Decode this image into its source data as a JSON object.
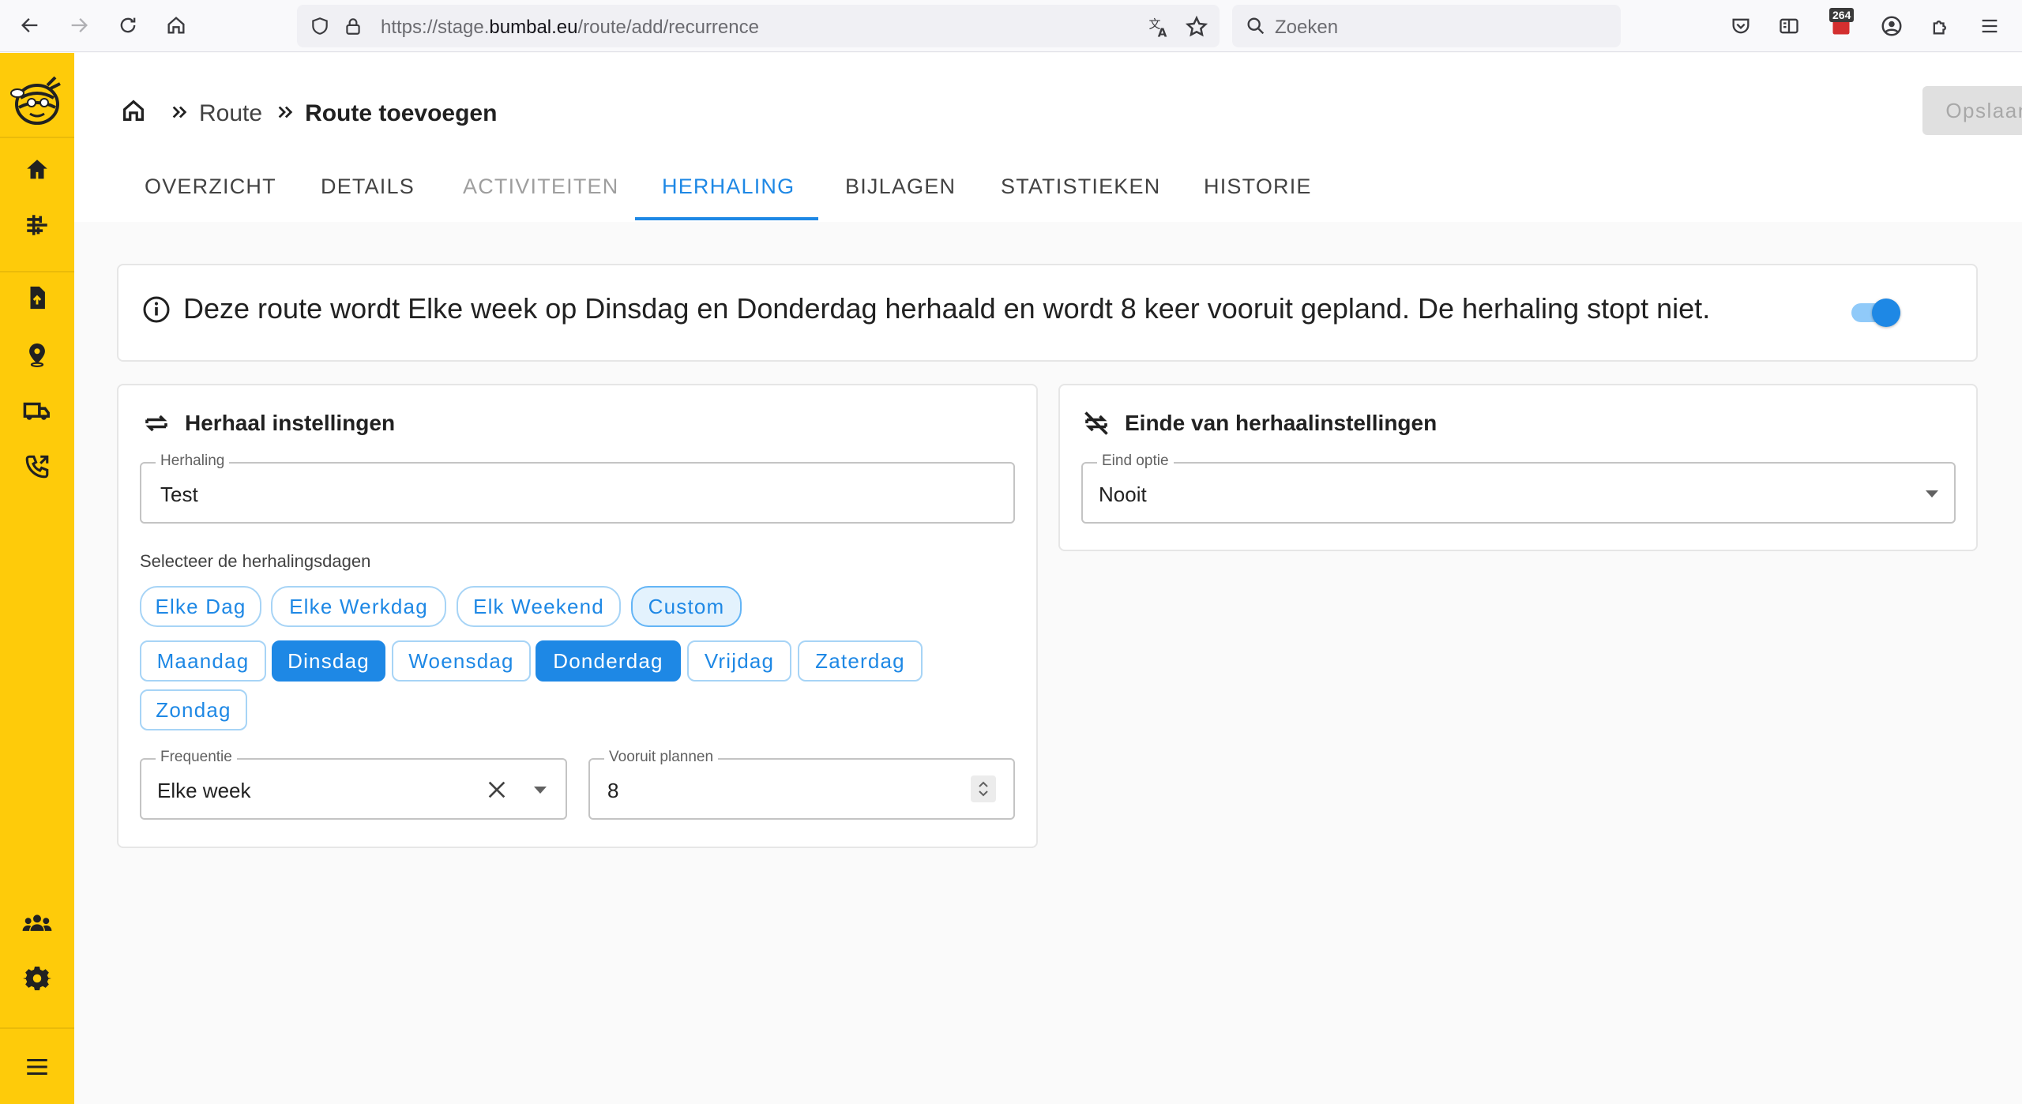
{
  "browser": {
    "url_prefix": "https://stage.",
    "url_domain": "bumbal.eu",
    "url_path": "/route/add/recurrence",
    "search_placeholder": "Zoeken",
    "extension_badge": "264",
    "icons": [
      "back-arrow-icon",
      "forward-arrow-icon",
      "reload-icon",
      "home-icon",
      "shield-icon",
      "lock-icon",
      "translate-icon",
      "star-icon",
      "search-icon",
      "pocket-icon",
      "reader-icon",
      "extension-icon",
      "account-icon",
      "puzzle-icon",
      "menu-icon"
    ]
  },
  "sidebar": {
    "items": [
      {
        "name": "home",
        "icon": "home-icon"
      },
      {
        "name": "planning",
        "icon": "planning-icon"
      },
      {
        "name": "import",
        "icon": "file-upload-icon"
      },
      {
        "name": "locations",
        "icon": "map-pin-icon"
      },
      {
        "name": "vehicles",
        "icon": "truck-icon"
      },
      {
        "name": "calls",
        "icon": "phone-forward-icon"
      },
      {
        "name": "users",
        "icon": "people-icon"
      },
      {
        "name": "settings",
        "icon": "gear-icon"
      },
      {
        "name": "menu",
        "icon": "hamburger-icon"
      }
    ],
    "accent": "#fecb0a"
  },
  "header": {
    "breadcrumb": {
      "parent": "Route",
      "current": "Route toevoegen"
    },
    "save_label": "Opslaan",
    "tabs": [
      {
        "label": "OVERZICHT",
        "state": "normal"
      },
      {
        "label": "DETAILS",
        "state": "normal"
      },
      {
        "label": "ACTIVITEITEN",
        "state": "disabled"
      },
      {
        "label": "HERHALING",
        "state": "active"
      },
      {
        "label": "BIJLAGEN",
        "state": "normal"
      },
      {
        "label": "STATISTIEKEN",
        "state": "normal"
      },
      {
        "label": "HISTORIE",
        "state": "normal"
      }
    ]
  },
  "summary": {
    "text": "Deze route wordt Elke week op Dinsdag en Donderdag herhaald en wordt 8 keer vooruit gepland. De herhaling stopt niet.",
    "toggle_on": true
  },
  "repeat_settings": {
    "title": "Herhaal instellingen",
    "name_field": {
      "label": "Herhaling",
      "value": "Test"
    },
    "days_label": "Selecteer de herhalingsdagen",
    "presets": [
      {
        "label": "Elke Dag",
        "selected": false
      },
      {
        "label": "Elke Werkdag",
        "selected": false
      },
      {
        "label": "Elk Weekend",
        "selected": false
      },
      {
        "label": "Custom",
        "selected": true
      }
    ],
    "days": [
      {
        "label": "Maandag",
        "selected": false
      },
      {
        "label": "Dinsdag",
        "selected": true
      },
      {
        "label": "Woensdag",
        "selected": false
      },
      {
        "label": "Donderdag",
        "selected": true
      },
      {
        "label": "Vrijdag",
        "selected": false
      },
      {
        "label": "Zaterdag",
        "selected": false
      },
      {
        "label": "Zondag",
        "selected": false
      }
    ],
    "frequency": {
      "label": "Frequentie",
      "value": "Elke week"
    },
    "plan_ahead": {
      "label": "Vooruit plannen",
      "value": "8"
    }
  },
  "end_settings": {
    "title": "Einde van herhaalinstellingen",
    "end_option": {
      "label": "Eind optie",
      "value": "Nooit"
    }
  },
  "colors": {
    "primary": "#1e88e5",
    "sidebar": "#fecb0a"
  }
}
